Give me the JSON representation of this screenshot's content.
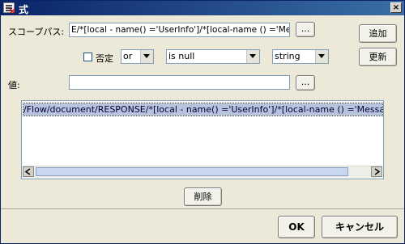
{
  "window": {
    "title": "式",
    "close_label": "×"
  },
  "scope_path": {
    "label": "スコープパス:",
    "value": "E/*[local - name() ='UserInfo']/*[local-name () ='Message']",
    "browse_label": "..."
  },
  "condition": {
    "negate_label": "否定",
    "negate_checked": false,
    "logic_operator": "or",
    "comparison": "is null",
    "data_type": "string"
  },
  "value_field": {
    "label": "値:",
    "value": "",
    "browse_label": "..."
  },
  "buttons": {
    "add": "追加",
    "update": "更新",
    "delete": "削除",
    "ok": "OK",
    "cancel": "キャンセル"
  },
  "expressions": [
    "/Flow/document/RESPONSE/*[local - name() ='UserInfo']/*[local-name () ='Message'] (is null) )"
  ]
}
